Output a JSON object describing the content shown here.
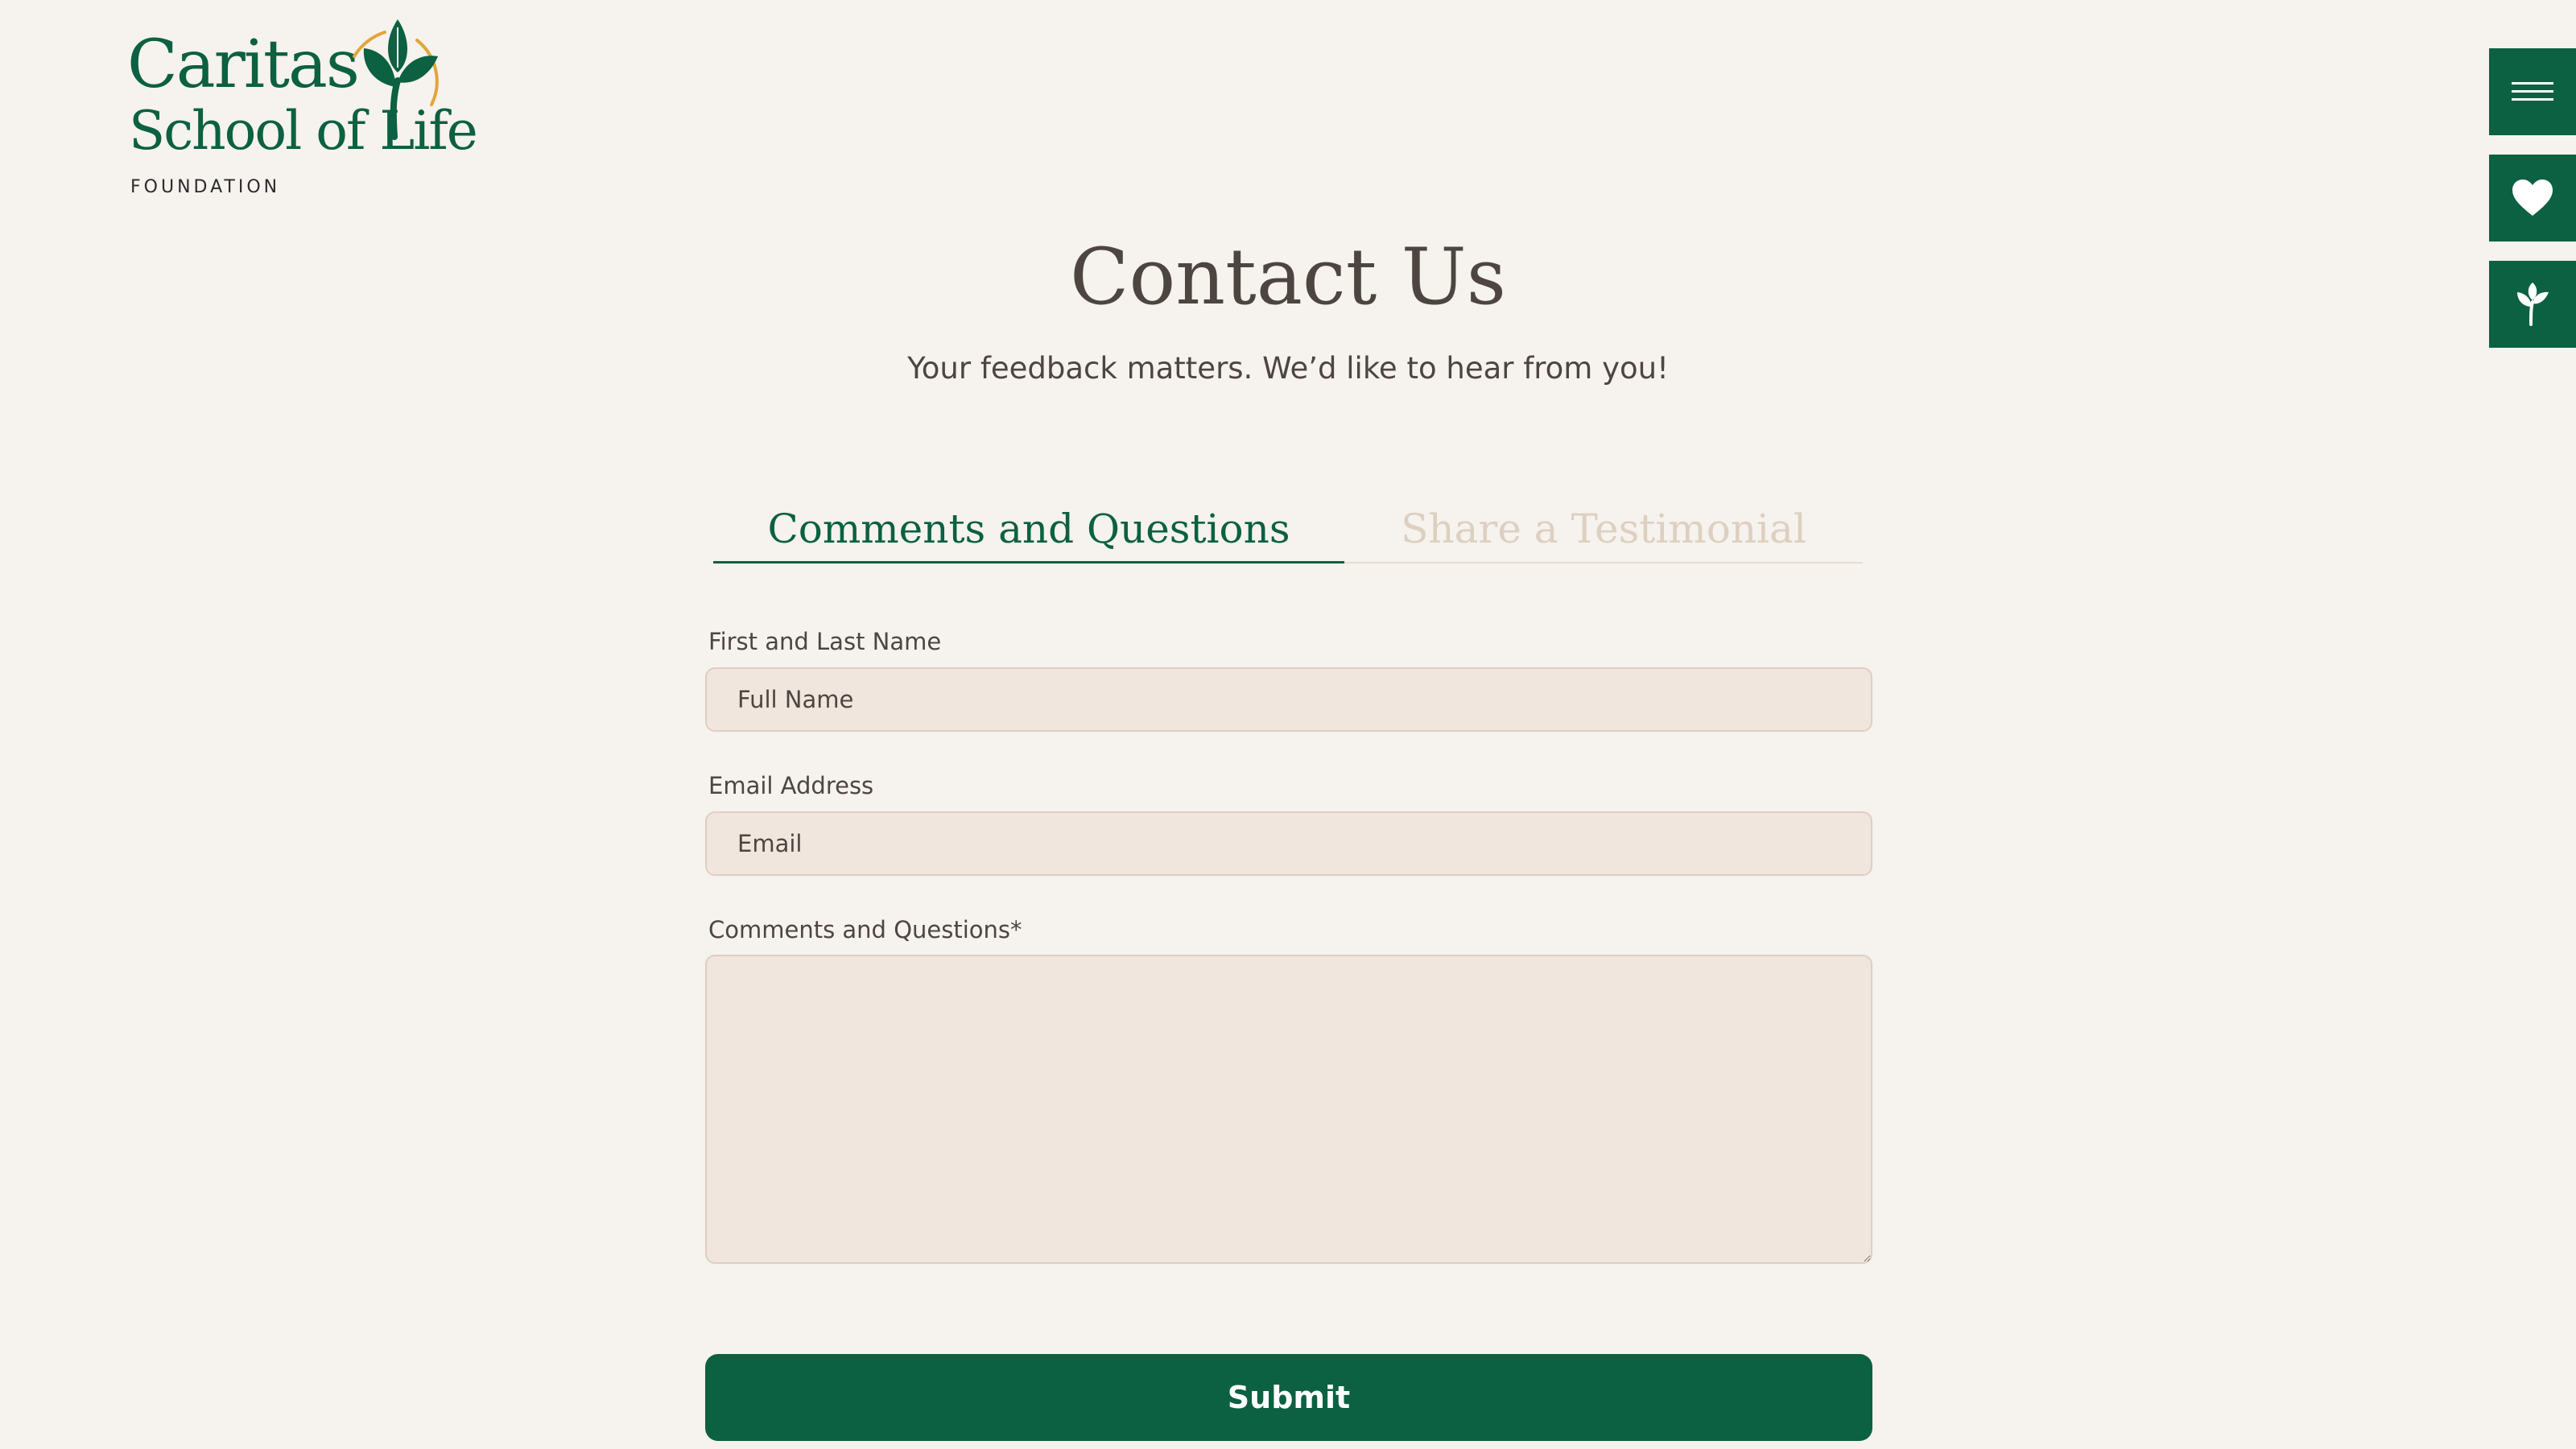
{
  "logo": {
    "line1": "Caritas",
    "line2": "School of Life",
    "line3": "FOUNDATION"
  },
  "side_actions": [
    {
      "icon": "hamburger-menu-icon"
    },
    {
      "icon": "heart-icon"
    },
    {
      "icon": "sprout-icon"
    }
  ],
  "header": {
    "title": "Contact Us",
    "subtitle": "Your feedback matters. We’d like to hear from you!"
  },
  "tabs": [
    {
      "label": "Comments and Questions",
      "active": true
    },
    {
      "label": "Share a Testimonial",
      "active": false
    }
  ],
  "form": {
    "name": {
      "label": "First and Last Name",
      "placeholder": "Full Name",
      "value": ""
    },
    "email": {
      "label": "Email Address",
      "placeholder": "Email",
      "value": ""
    },
    "comments": {
      "label": "Comments and Questions*",
      "value": ""
    },
    "submit_label": "Submit"
  },
  "colors": {
    "brand_green": "#0b6141",
    "page_background": "#f6f2ee",
    "input_background": "#f0e6dd",
    "logo_accent": "#e0a63a",
    "inactive_tab": "#ddd0c0"
  }
}
